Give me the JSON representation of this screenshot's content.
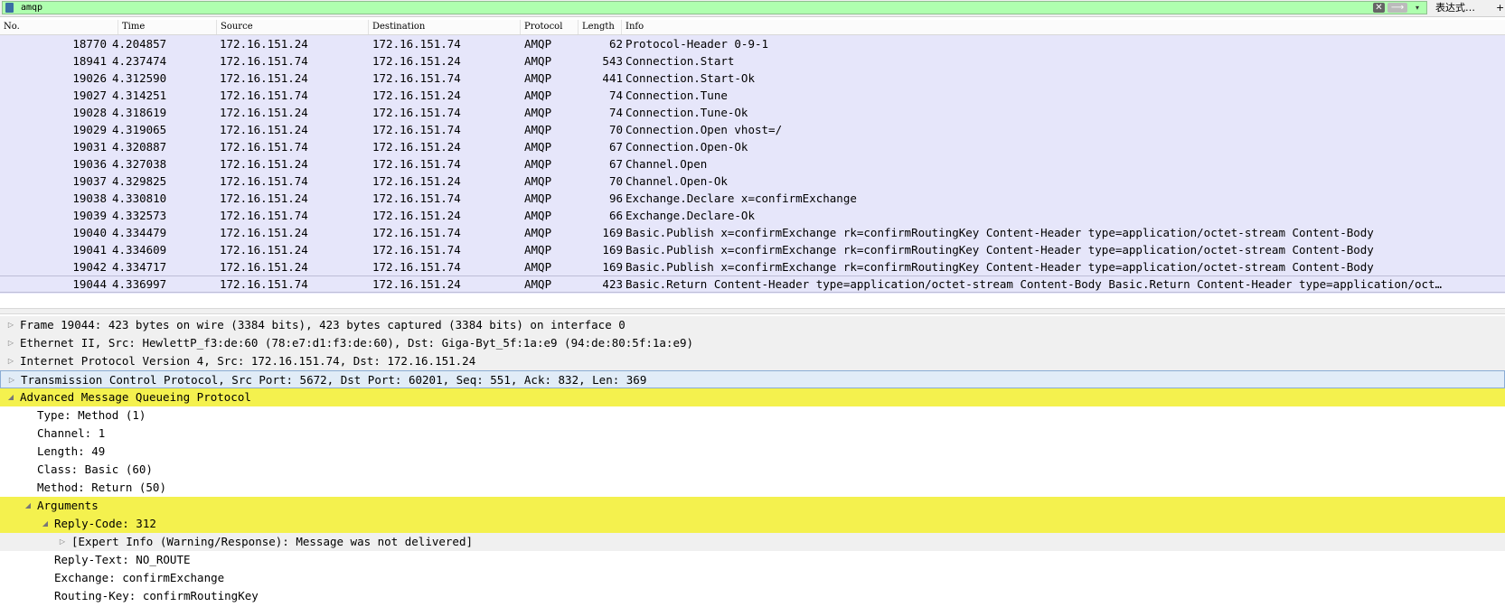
{
  "filter": {
    "value": "amqp",
    "clear_label": "✕",
    "apply_label": "⟶",
    "dropdown_label": "▾",
    "expression_label": "表达式…",
    "plus_label": "+"
  },
  "columns": {
    "no": "No.",
    "time": "Time",
    "source": "Source",
    "destination": "Destination",
    "protocol": "Protocol",
    "length": "Length",
    "info": "Info"
  },
  "packets": [
    {
      "no": "18770",
      "time": "4.204857",
      "src": "172.16.151.24",
      "dst": "172.16.151.74",
      "proto": "AMQP",
      "len": "62",
      "info": "Protocol-Header 0-9-1"
    },
    {
      "no": "18941",
      "time": "4.237474",
      "src": "172.16.151.74",
      "dst": "172.16.151.24",
      "proto": "AMQP",
      "len": "543",
      "info": "Connection.Start"
    },
    {
      "no": "19026",
      "time": "4.312590",
      "src": "172.16.151.24",
      "dst": "172.16.151.74",
      "proto": "AMQP",
      "len": "441",
      "info": "Connection.Start-Ok"
    },
    {
      "no": "19027",
      "time": "4.314251",
      "src": "172.16.151.74",
      "dst": "172.16.151.24",
      "proto": "AMQP",
      "len": "74",
      "info": "Connection.Tune"
    },
    {
      "no": "19028",
      "time": "4.318619",
      "src": "172.16.151.24",
      "dst": "172.16.151.74",
      "proto": "AMQP",
      "len": "74",
      "info": "Connection.Tune-Ok"
    },
    {
      "no": "19029",
      "time": "4.319065",
      "src": "172.16.151.24",
      "dst": "172.16.151.74",
      "proto": "AMQP",
      "len": "70",
      "info": "Connection.Open vhost=/"
    },
    {
      "no": "19031",
      "time": "4.320887",
      "src": "172.16.151.74",
      "dst": "172.16.151.24",
      "proto": "AMQP",
      "len": "67",
      "info": "Connection.Open-Ok"
    },
    {
      "no": "19036",
      "time": "4.327038",
      "src": "172.16.151.24",
      "dst": "172.16.151.74",
      "proto": "AMQP",
      "len": "67",
      "info": "Channel.Open"
    },
    {
      "no": "19037",
      "time": "4.329825",
      "src": "172.16.151.74",
      "dst": "172.16.151.24",
      "proto": "AMQP",
      "len": "70",
      "info": "Channel.Open-Ok"
    },
    {
      "no": "19038",
      "time": "4.330810",
      "src": "172.16.151.24",
      "dst": "172.16.151.74",
      "proto": "AMQP",
      "len": "96",
      "info": "Exchange.Declare x=confirmExchange"
    },
    {
      "no": "19039",
      "time": "4.332573",
      "src": "172.16.151.74",
      "dst": "172.16.151.24",
      "proto": "AMQP",
      "len": "66",
      "info": "Exchange.Declare-Ok"
    },
    {
      "no": "19040",
      "time": "4.334479",
      "src": "172.16.151.24",
      "dst": "172.16.151.74",
      "proto": "AMQP",
      "len": "169",
      "info": "Basic.Publish x=confirmExchange rk=confirmRoutingKey Content-Header type=application/octet-stream Content-Body"
    },
    {
      "no": "19041",
      "time": "4.334609",
      "src": "172.16.151.24",
      "dst": "172.16.151.74",
      "proto": "AMQP",
      "len": "169",
      "info": "Basic.Publish x=confirmExchange rk=confirmRoutingKey Content-Header type=application/octet-stream Content-Body"
    },
    {
      "no": "19042",
      "time": "4.334717",
      "src": "172.16.151.24",
      "dst": "172.16.151.74",
      "proto": "AMQP",
      "len": "169",
      "info": "Basic.Publish x=confirmExchange rk=confirmRoutingKey Content-Header type=application/octet-stream Content-Body"
    },
    {
      "no": "19044",
      "time": "4.336997",
      "src": "172.16.151.74",
      "dst": "172.16.151.24",
      "proto": "AMQP",
      "len": "423",
      "info": "Basic.Return Content-Header type=application/octet-stream Content-Body Basic.Return Content-Header type=application/oct…"
    }
  ],
  "details": [
    {
      "text": "Frame 19044: 423 bytes on wire (3384 bits), 423 bytes captured (3384 bits) on interface 0",
      "arrow": "▷",
      "style": "gray",
      "indent": 0
    },
    {
      "text": "Ethernet II, Src: HewlettP_f3:de:60 (78:e7:d1:f3:de:60), Dst: Giga-Byt_5f:1a:e9 (94:de:80:5f:1a:e9)",
      "arrow": "▷",
      "style": "gray",
      "indent": 0
    },
    {
      "text": "Internet Protocol Version 4, Src: 172.16.151.74, Dst: 172.16.151.24",
      "arrow": "▷",
      "style": "gray",
      "indent": 0
    },
    {
      "text": "Transmission Control Protocol, Src Port: 5672, Dst Port: 60201, Seq: 551, Ack: 832, Len: 369",
      "arrow": "▷",
      "style": "hl",
      "indent": 0
    },
    {
      "text": "Advanced Message Queueing Protocol",
      "arrow": "◢",
      "style": "yellow",
      "indent": 0
    },
    {
      "text": "Type: Method (1)",
      "arrow": "",
      "style": "",
      "indent": 1
    },
    {
      "text": "Channel: 1",
      "arrow": "",
      "style": "",
      "indent": 1
    },
    {
      "text": "Length: 49",
      "arrow": "",
      "style": "",
      "indent": 1
    },
    {
      "text": "Class: Basic (60)",
      "arrow": "",
      "style": "",
      "indent": 1
    },
    {
      "text": "Method: Return (50)",
      "arrow": "",
      "style": "",
      "indent": 1
    },
    {
      "text": "Arguments",
      "arrow": "◢",
      "style": "yellow",
      "indent": 1
    },
    {
      "text": "Reply-Code: 312",
      "arrow": "◢",
      "style": "yellow",
      "indent": 2
    },
    {
      "text": "[Expert Info (Warning/Response): Message was not delivered]",
      "arrow": "▷",
      "style": "gray",
      "indent": 3
    },
    {
      "text": "Reply-Text: NO_ROUTE",
      "arrow": "",
      "style": "",
      "indent": 2
    },
    {
      "text": "Exchange: confirmExchange",
      "arrow": "",
      "style": "",
      "indent": 2
    },
    {
      "text": "Routing-Key: confirmRoutingKey",
      "arrow": "",
      "style": "",
      "indent": 2
    }
  ],
  "selected_packet_index": 14
}
